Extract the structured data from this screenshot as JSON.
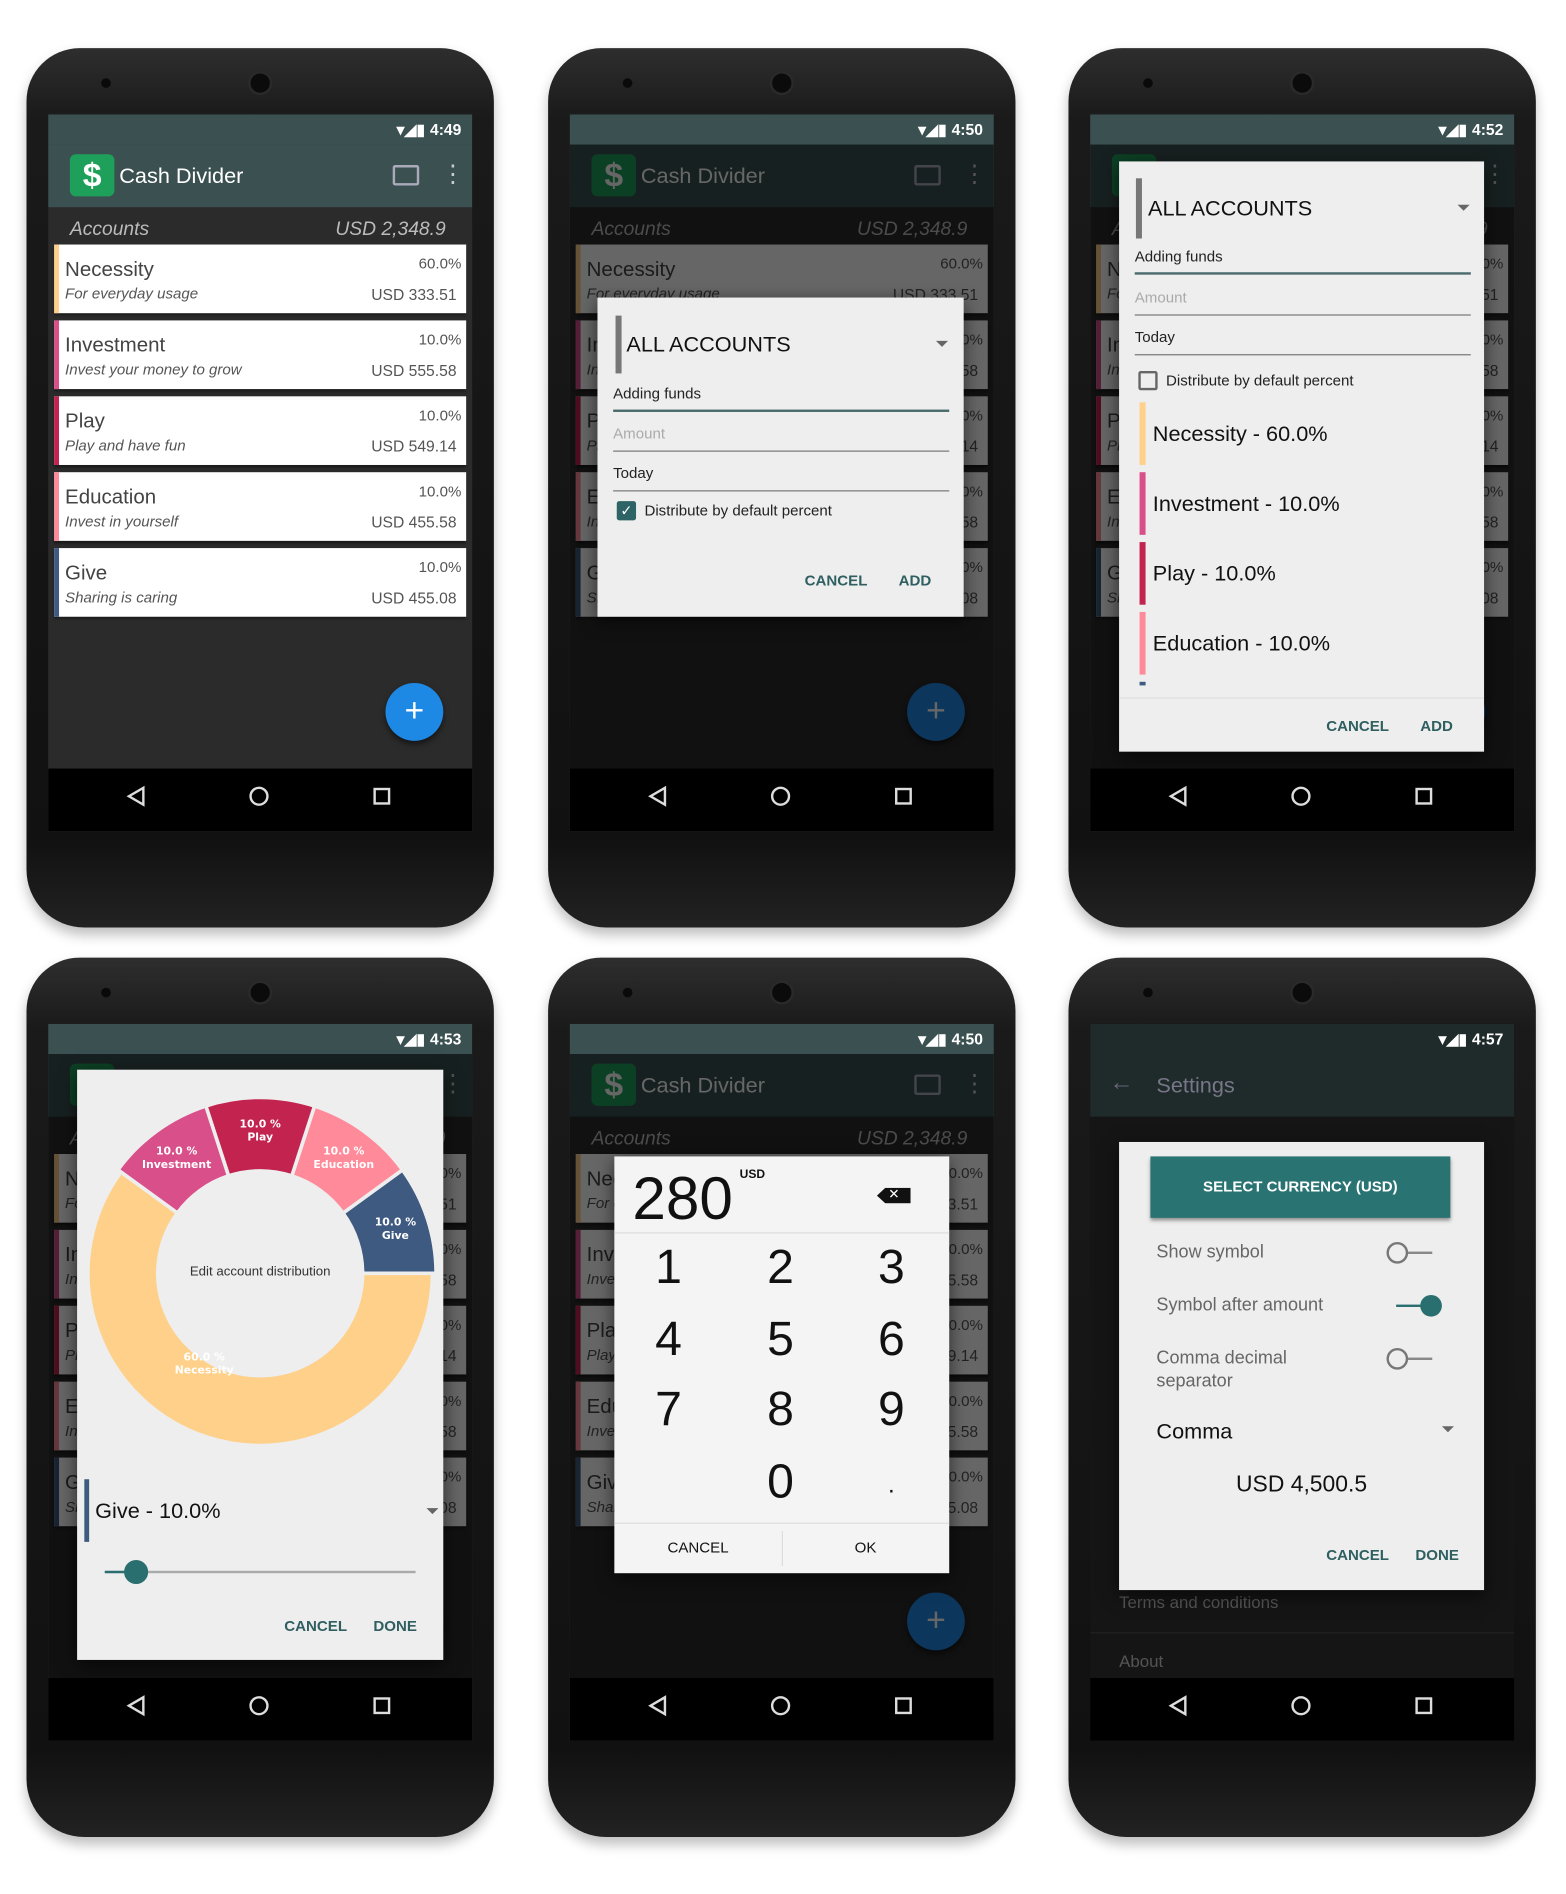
{
  "app": {
    "title": "Cash Divider",
    "logo_text": "$"
  },
  "accounts_header": {
    "label": "Accounts",
    "total": "USD 2,348.9"
  },
  "accounts": [
    {
      "name": "Necessity",
      "description": "For everyday usage",
      "percent": "60.0%",
      "amount": "USD 333.51",
      "color": "#ffd08a"
    },
    {
      "name": "Investment",
      "description": "Invest your money to grow",
      "percent": "10.0%",
      "amount": "USD 555.58",
      "color": "#d94f8a"
    },
    {
      "name": "Play",
      "description": "Play and have fun",
      "percent": "10.0%",
      "amount": "USD 549.14",
      "color": "#c2234f"
    },
    {
      "name": "Education",
      "description": "Invest in yourself",
      "percent": "10.0%",
      "amount": "USD 455.58",
      "color": "#ff8a9a"
    },
    {
      "name": "Give",
      "description": "Sharing is caring",
      "percent": "10.0%",
      "amount": "USD 455.08",
      "color": "#3f5a80"
    }
  ],
  "fab_icon": "plus-icon",
  "nav_icons": [
    "back-icon",
    "home-icon",
    "recents-icon"
  ],
  "screens": {
    "s1": {
      "time": "4:49"
    },
    "s2": {
      "time": "4:50",
      "dialog": {
        "account": "ALL ACCOUNTS",
        "description": "Adding funds",
        "amount_placeholder": "Amount",
        "date": "Today",
        "distribute_label": "Distribute by default percent",
        "distribute_checked": true,
        "cancel": "CANCEL",
        "add": "ADD"
      }
    },
    "s3": {
      "time": "4:52",
      "dialog": {
        "account": "ALL ACCOUNTS",
        "description": "Adding funds",
        "amount_placeholder": "Amount",
        "date": "Today",
        "distribute_label": "Distribute by default percent",
        "distribute_checked": false,
        "distribution": [
          "Necessity - 60.0%",
          "Investment - 10.0%",
          "Play - 10.0%",
          "Education - 10.0%"
        ],
        "cancel": "CANCEL",
        "add": "ADD"
      }
    },
    "s4": {
      "time": "4:53",
      "dialog": {
        "center_label": "Edit account distribution",
        "selected": "Give - 10.0%",
        "slider_percent": 10,
        "cancel": "CANCEL",
        "done": "DONE",
        "slices": [
          {
            "label": "Give",
            "value": 10.0,
            "value_label": "10.0 %",
            "color": "#3f5a80"
          },
          {
            "label": "Education",
            "value": 10.0,
            "value_label": "10.0 %",
            "color": "#ff8a9a"
          },
          {
            "label": "Play",
            "value": 10.0,
            "value_label": "10.0 %",
            "color": "#c2234f"
          },
          {
            "label": "Investment",
            "value": 10.0,
            "value_label": "10.0 %",
            "color": "#d94f8a"
          },
          {
            "label": "Necessity",
            "value": 60.0,
            "value_label": "60.0 %",
            "color": "#ffd08a"
          }
        ]
      }
    },
    "s5": {
      "time": "4:50",
      "keypad": {
        "value": "280",
        "currency": "USD",
        "keys": [
          "1",
          "2",
          "3",
          "4",
          "5",
          "6",
          "7",
          "8",
          "9",
          "",
          "0",
          "."
        ],
        "cancel": "CANCEL",
        "ok": "OK"
      }
    },
    "s6": {
      "time": "4:57",
      "title": "Settings",
      "dialog": {
        "select_currency": "SELECT CURRENCY (USD)",
        "show_symbol": "Show symbol",
        "show_symbol_on": false,
        "symbol_after": "Symbol after amount",
        "symbol_after_on": true,
        "comma_decimal": "Comma decimal separator",
        "comma_decimal_on": false,
        "separator": "Comma",
        "preview": "USD 4,500.5",
        "cancel": "CANCEL",
        "done": "DONE"
      },
      "background_items": [
        "Terms and conditions",
        "About"
      ]
    }
  },
  "colors": {
    "app_bar": "#3b5051",
    "accent": "#2f6466",
    "fab": "#1e88e5"
  }
}
